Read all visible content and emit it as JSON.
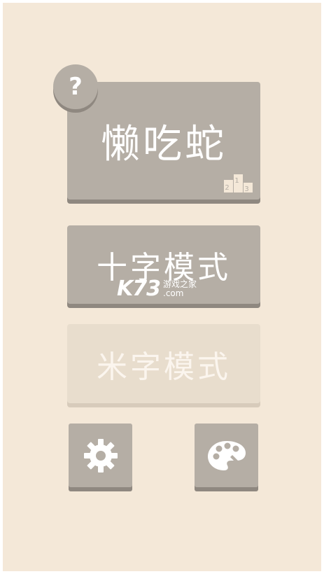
{
  "game": {
    "title": "懒吃蛇",
    "help_label": "?",
    "modes": [
      "十字模式",
      "米字模式"
    ]
  },
  "watermark": {
    "logo": "K73",
    "line1": "游戏之家",
    "line2": ".com"
  },
  "icons": {
    "help": "question-mark-icon",
    "leaderboard": "podium-icon",
    "settings": "gear-icon",
    "theme": "palette-icon"
  },
  "colors": {
    "background": "#f4e8d8",
    "button": "#b5aea5",
    "button_shadow": "#8f8880",
    "button_disabled": "#e8ddcd",
    "text": "#ffffff"
  }
}
